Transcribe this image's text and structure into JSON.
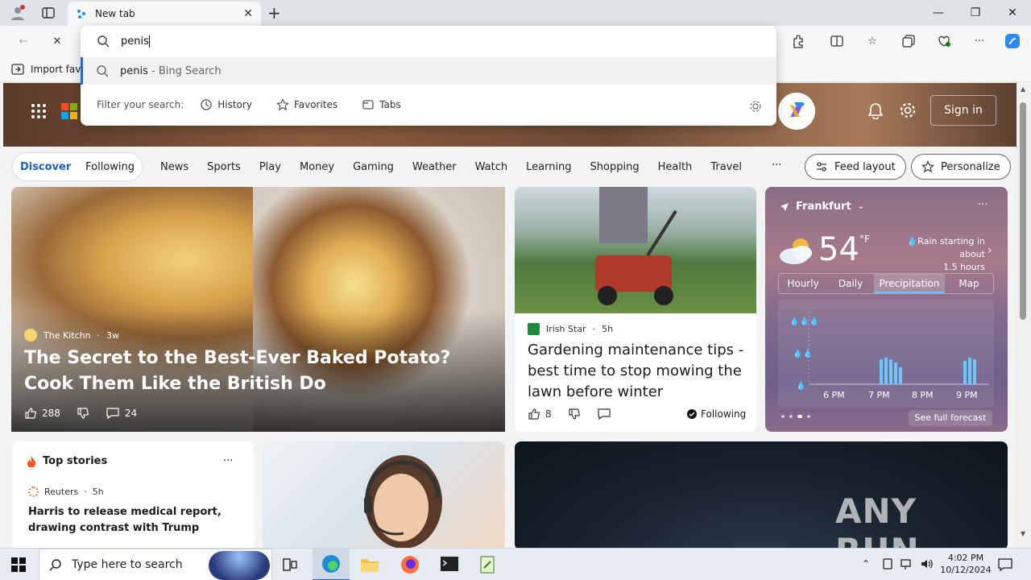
{
  "browser": {
    "tab_title": "New tab",
    "omnibox_text": "penis",
    "suggestion": {
      "query": "penis",
      "source": " - Bing Search"
    },
    "filter_label": "Filter your search:",
    "filters": [
      "History",
      "Favorites",
      "Tabs"
    ],
    "favorites_import": "Import favo"
  },
  "msn": {
    "sign_in": "Sign in",
    "nav_toggle": [
      "Discover",
      "Following"
    ],
    "nav_items": [
      "News",
      "Sports",
      "Play",
      "Money",
      "Gaming",
      "Weather",
      "Watch",
      "Learning",
      "Shopping",
      "Health",
      "Travel"
    ],
    "more": "···",
    "feed_layout": "Feed layout",
    "personalize": "Personalize",
    "hero_card": {
      "source": "The Kitchn",
      "age": "3w",
      "title": "The Secret to the Best-Ever Baked Potato? Cook Them Like the British Do",
      "likes": "288",
      "comments": "24"
    },
    "second_card": {
      "source": "Irish Star",
      "age": "5h",
      "title": "Gardening maintenance tips - best time to stop mowing the lawn before winter",
      "likes": "8",
      "following": "Following"
    },
    "weather": {
      "city": "Frankfurt",
      "temp": "54",
      "unit": "°F",
      "summary_line1": "Rain starting in about",
      "summary_line2": "1.5 hours",
      "tabs": [
        "Hourly",
        "Daily",
        "Precipitation",
        "Map"
      ],
      "times": [
        "6 PM",
        "7 PM",
        "8 PM",
        "9 PM"
      ],
      "see_full": "See full forecast"
    },
    "top_stories": {
      "title": "Top stories",
      "source": "Reuters",
      "age": "5h",
      "headline": "Harris to release medical report, drawing contrast with Trump"
    },
    "watermark": "ANY RUN"
  },
  "taskbar": {
    "search_placeholder": "Type here to search",
    "time": "4:02 PM",
    "date": "10/12/2024"
  },
  "colors": {
    "accent": "#1f5fbf",
    "suggestion_bar": "#2b67c8"
  }
}
